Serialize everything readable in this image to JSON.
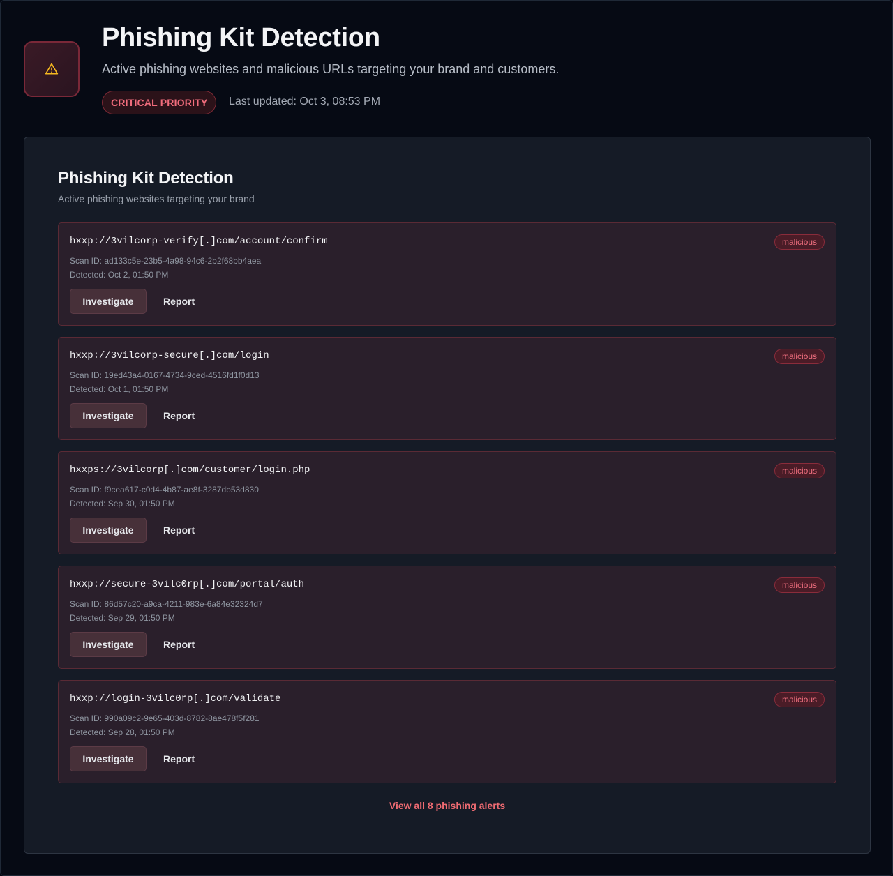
{
  "header": {
    "icon": "warning-triangle-icon",
    "title": "Phishing Kit Detection",
    "subtitle": "Active phishing websites and malicious URLs targeting your brand and customers.",
    "priority_badge": "CRITICAL PRIORITY",
    "last_updated": "Last updated: Oct 3, 08:53 PM"
  },
  "panel": {
    "title": "Phishing Kit Detection",
    "subtitle": "Active phishing websites targeting your brand",
    "alerts": [
      {
        "url": "hxxp://3vilcorp-verify[.]com/account/confirm",
        "status": "malicious",
        "scan_id": "Scan ID: ad133c5e-23b5-4a98-94c6-2b2f68bb4aea",
        "detected": "Detected: Oct 2, 01:50 PM",
        "investigate_label": "Investigate",
        "report_label": "Report"
      },
      {
        "url": "hxxp://3vilcorp-secure[.]com/login",
        "status": "malicious",
        "scan_id": "Scan ID: 19ed43a4-0167-4734-9ced-4516fd1f0d13",
        "detected": "Detected: Oct 1, 01:50 PM",
        "investigate_label": "Investigate",
        "report_label": "Report"
      },
      {
        "url": "hxxps://3vilcorp[.]com/customer/login.php",
        "status": "malicious",
        "scan_id": "Scan ID: f9cea617-c0d4-4b87-ae8f-3287db53d830",
        "detected": "Detected: Sep 30, 01:50 PM",
        "investigate_label": "Investigate",
        "report_label": "Report"
      },
      {
        "url": "hxxp://secure-3vilc0rp[.]com/portal/auth",
        "status": "malicious",
        "scan_id": "Scan ID: 86d57c20-a9ca-4211-983e-6a84e32324d7",
        "detected": "Detected: Sep 29, 01:50 PM",
        "investigate_label": "Investigate",
        "report_label": "Report"
      },
      {
        "url": "hxxp://login-3vilc0rp[.]com/validate",
        "status": "malicious",
        "scan_id": "Scan ID: 990a09c2-9e65-403d-8782-8ae478f5f281",
        "detected": "Detected: Sep 28, 01:50 PM",
        "investigate_label": "Investigate",
        "report_label": "Report"
      }
    ],
    "view_all": "View all 8 phishing alerts"
  },
  "colors": {
    "accent_red": "#f26d7d",
    "warning_yellow": "#f5b820",
    "background": "#060a14",
    "panel": "#151b26",
    "card": "#2a1f2b"
  }
}
